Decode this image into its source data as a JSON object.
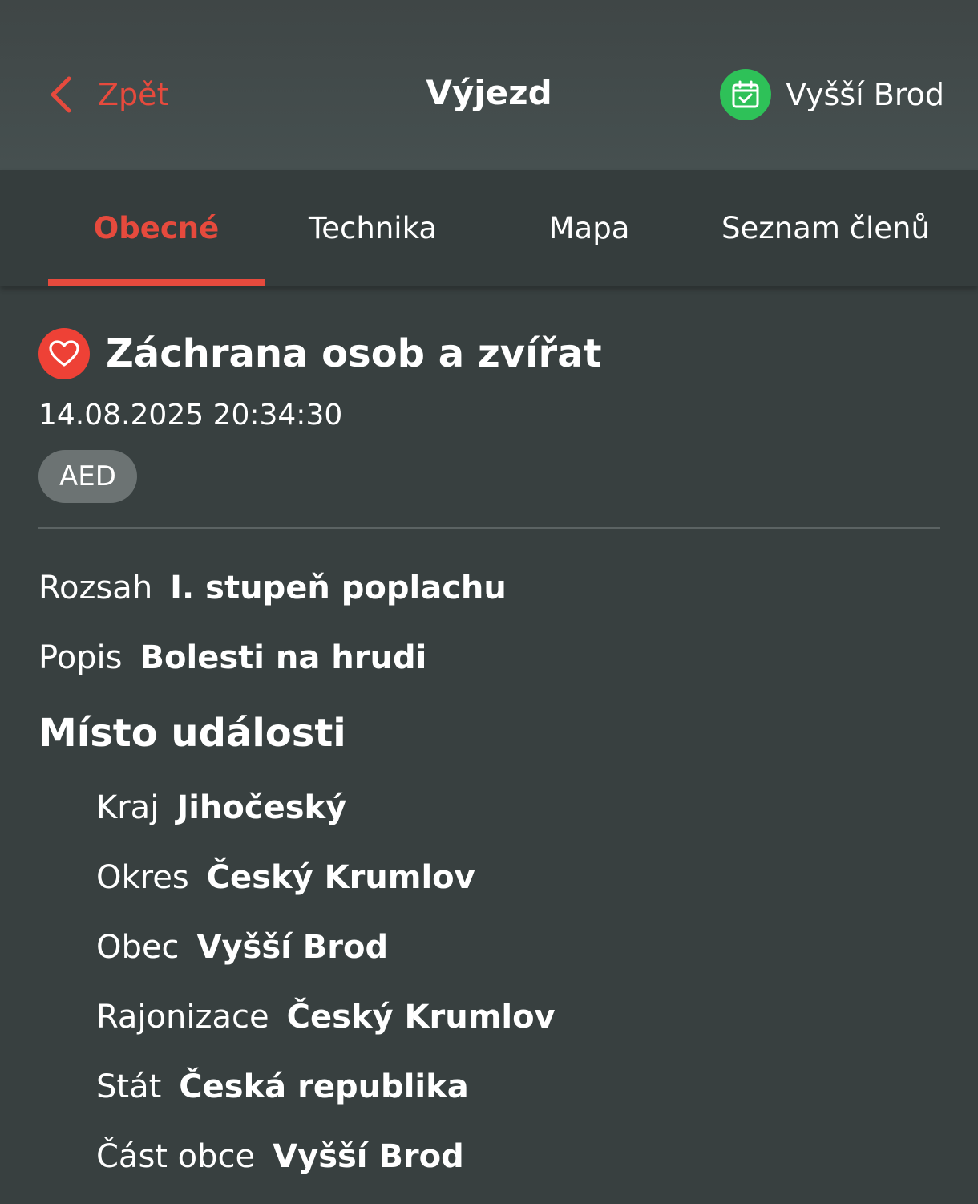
{
  "header": {
    "back_label": "Zpět",
    "title": "Výjezd",
    "org_label": "Vyšší Brod"
  },
  "tabs": [
    {
      "label": "Obecné",
      "active": true
    },
    {
      "label": "Technika",
      "active": false
    },
    {
      "label": "Mapa",
      "active": false
    },
    {
      "label": "Seznam členů",
      "active": false
    }
  ],
  "event": {
    "title": "Záchrana osob a zvířat",
    "datetime": "14.08.2025 20:34:30",
    "badge": "AED"
  },
  "details": {
    "rozsah_label": "Rozsah",
    "rozsah_value": "I. stupeň poplachu",
    "popis_label": "Popis",
    "popis_value": "Bolesti na hrudi"
  },
  "location": {
    "section_title": "Místo události",
    "rows": [
      {
        "label": "Kraj",
        "value": "Jihočeský"
      },
      {
        "label": "Okres",
        "value": "Český Krumlov"
      },
      {
        "label": "Obec",
        "value": "Vyšší Brod"
      },
      {
        "label": "Rajonizace",
        "value": "Český Krumlov"
      },
      {
        "label": "Stát",
        "value": "Česká republika"
      },
      {
        "label": "Část obce",
        "value": "Vyšší Brod"
      }
    ]
  },
  "colors": {
    "accent": "#e64a3d",
    "background": "#384040",
    "header": "#434b4b",
    "org_icon": "#2ec158",
    "badge": "#6c7373"
  },
  "icons": {
    "back": "chevron-left-icon",
    "org": "calendar-check-icon",
    "event": "heart-icon"
  }
}
